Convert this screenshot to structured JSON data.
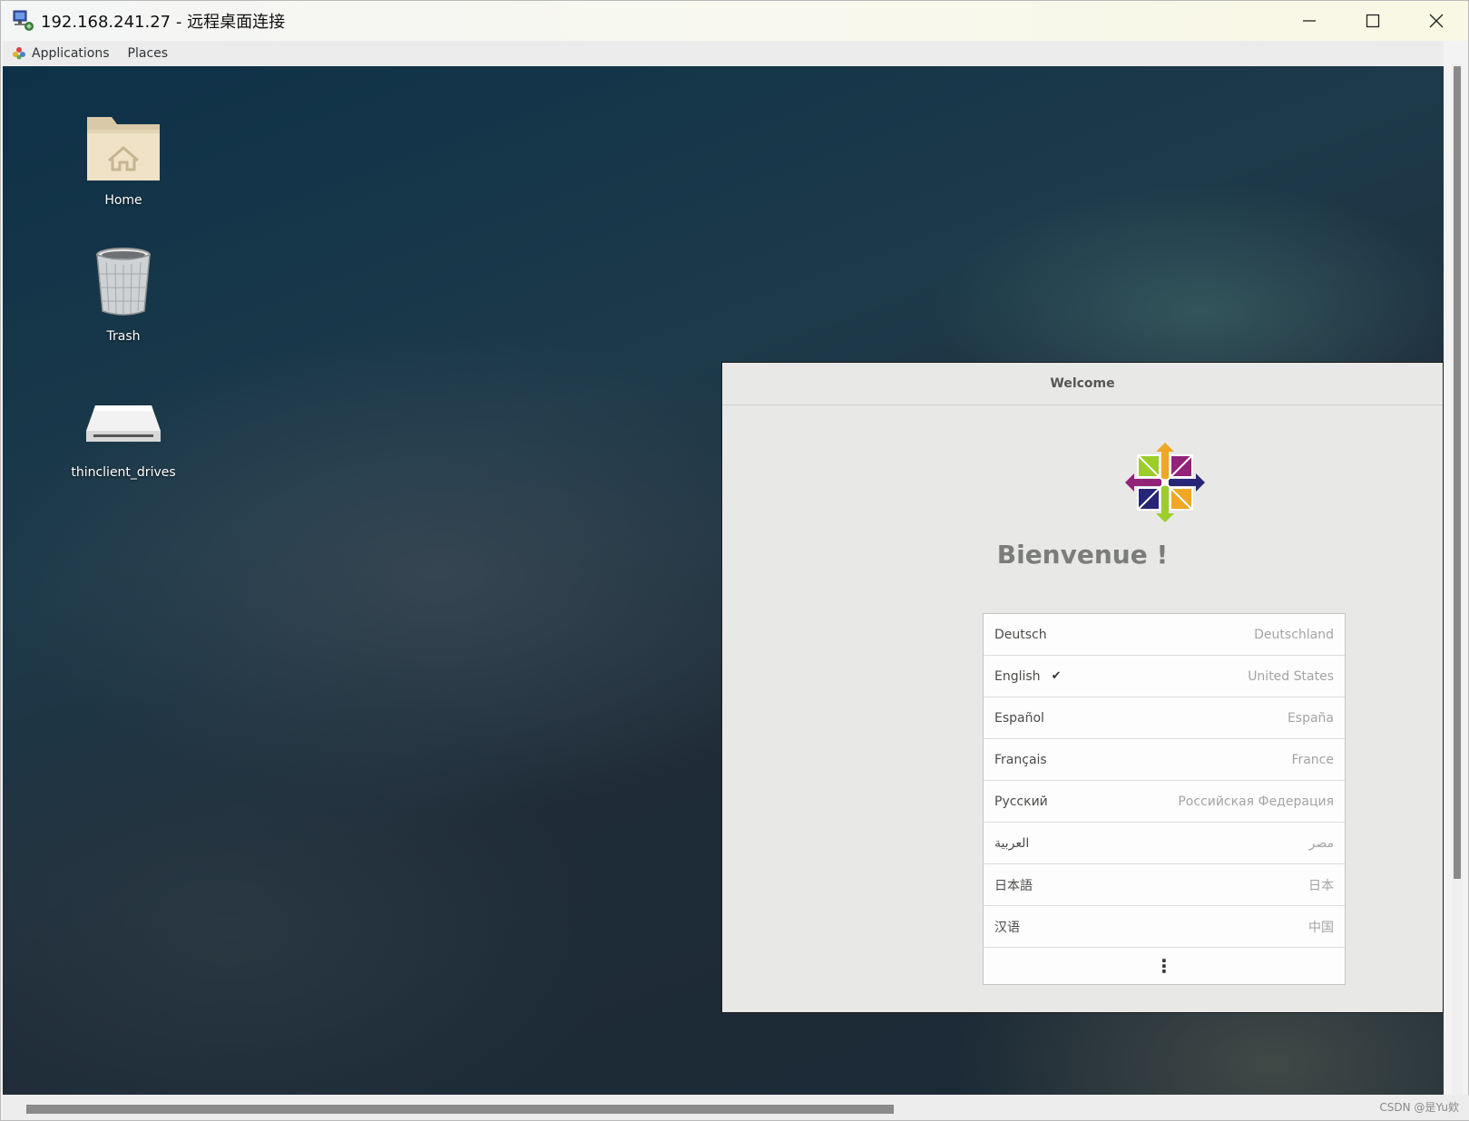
{
  "window": {
    "title": "192.168.241.27 - 远程桌面连接",
    "title_icon": "remote-desktop-icon",
    "controls": [
      "minimize-icon",
      "maximize-icon",
      "close-icon"
    ]
  },
  "menubar": {
    "applications_label": "Applications",
    "places_label": "Places"
  },
  "desktop": {
    "icons": [
      {
        "label": "Home",
        "icon": "home-folder-icon"
      },
      {
        "label": "Trash",
        "icon": "trash-icon"
      },
      {
        "label": "thinclient_drives",
        "icon": "drive-icon"
      }
    ]
  },
  "welcome": {
    "header_title": "Welcome",
    "heading": "Bienvenue !",
    "logo": "centos-logo-icon",
    "languages": [
      {
        "name": "Deutsch",
        "region": "Deutschland",
        "selected": false
      },
      {
        "name": "English",
        "region": "United States",
        "selected": true
      },
      {
        "name": "Español",
        "region": "España",
        "selected": false
      },
      {
        "name": "Français",
        "region": "France",
        "selected": false
      },
      {
        "name": "Русский",
        "region": "Российская Федерация",
        "selected": false
      },
      {
        "name": "العربية",
        "region": "مصر",
        "selected": false
      },
      {
        "name": "日本語",
        "region": "日本",
        "selected": false
      },
      {
        "name": "汉语",
        "region": "中国",
        "selected": false
      }
    ],
    "check_mark": "✔",
    "more_label": "⋮"
  },
  "watermark": "CSDN @是Yu欸",
  "colors": {
    "desktop_dark": "#1b2a36",
    "dialog_bg": "#e8e8e7",
    "list_bg": "#fdfdfd"
  }
}
